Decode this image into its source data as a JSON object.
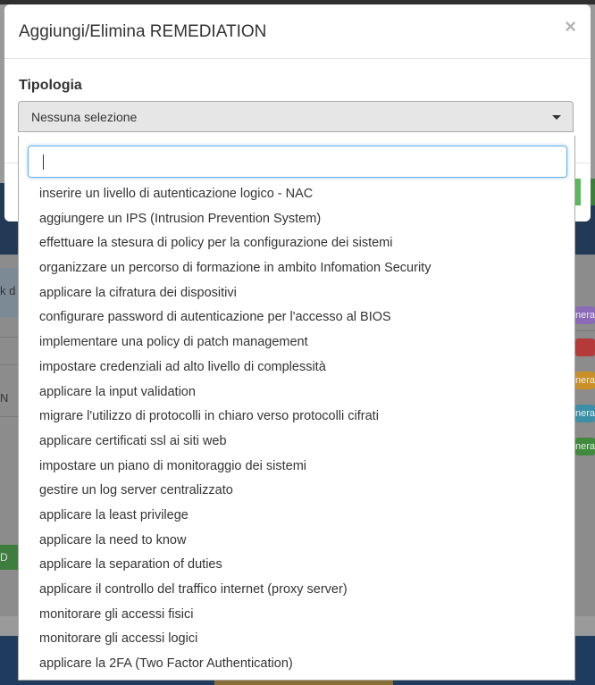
{
  "background": {
    "left_fragment_1": "k d",
    "left_fragment_2": "N",
    "green_button_fragment": "D",
    "badges": [
      {
        "label": "nera",
        "color": "#8b6bb8"
      },
      {
        "label": "",
        "color": "#b53a3a"
      },
      {
        "label": "nera",
        "color": "#c9902a"
      },
      {
        "label": "nera",
        "color": "#3b8fa6"
      },
      {
        "label": "nera",
        "color": "#3f8a3f"
      }
    ]
  },
  "modal": {
    "title": "Aggiungi/Elimina REMEDIATION",
    "close_symbol": "×",
    "field_label": "Tipologia",
    "select_value": "Nessuna selezione"
  },
  "dropdown": {
    "search_value": "",
    "options": [
      "inserire un livello di autenticazione logico - NAC",
      "aggiungere un IPS (Intrusion Prevention System)",
      "effettuare la stesura di policy per la configurazione dei sistemi",
      "organizzare un percorso di formazione in ambito Infomation Security",
      "applicare la cifratura dei dispositivi",
      "configurare password di autenticazione per l'accesso al BIOS",
      "implementare una policy di patch management",
      "impostare credenziali ad alto livello di complessità",
      "applicare la input validation",
      "migrare l'utilizzo di protocolli in chiaro verso protocolli cifrati",
      "applicare certificati ssl ai siti web",
      "impostare un piano di monitoraggio dei sistemi",
      "gestire un log server centralizzato",
      "applicare la least privilege",
      "applicare la need to know",
      "applicare la separation of duties",
      "applicare il controllo del traffico internet (proxy server)",
      "monitorare gli accessi fisici",
      "monitorare gli accessi logici",
      "applicare la 2FA (Two Factor Authentication)"
    ]
  },
  "colors": {
    "focus_border": "#66afe9",
    "select_bg": "#e6e6e6"
  }
}
